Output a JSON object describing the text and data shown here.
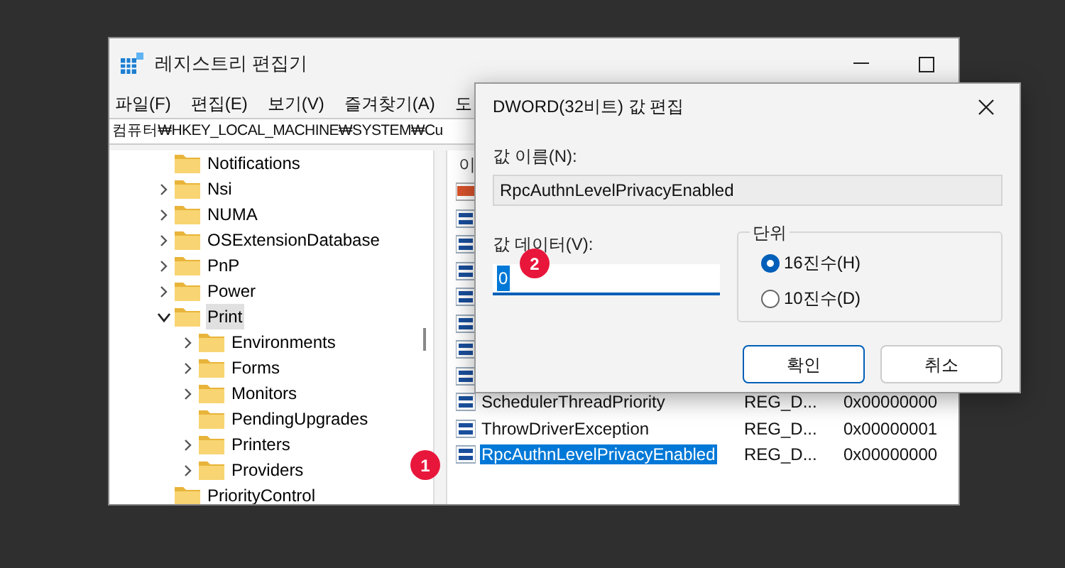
{
  "window": {
    "title": "레지스트리 편집기",
    "menu": [
      "파일(F)",
      "편집(E)",
      "보기(V)",
      "즐겨찾기(A)",
      "도"
    ],
    "address": "컴퓨터₩HKEY_LOCAL_MACHINE₩SYSTEM₩Cu"
  },
  "tree": [
    {
      "label": "Notifications",
      "selected": false
    },
    {
      "label": "Nsi",
      "expanded": false,
      "selected": false
    },
    {
      "label": "NUMA",
      "expanded": false,
      "selected": false
    },
    {
      "label": "OSExtensionDatabase",
      "expanded": false,
      "selected": false
    },
    {
      "label": "PnP",
      "expanded": false,
      "selected": false
    },
    {
      "label": "Power",
      "expanded": false,
      "selected": false
    },
    {
      "label": "Print",
      "expanded": true,
      "selected": true,
      "children": [
        {
          "label": "Environments",
          "expanded": false,
          "selected": false
        },
        {
          "label": "Forms",
          "expanded": false,
          "selected": false
        },
        {
          "label": "Monitors",
          "expanded": false,
          "selected": false
        },
        {
          "label": "PendingUpgrades",
          "selected": false
        },
        {
          "label": "Printers",
          "expanded": false,
          "selected": false
        },
        {
          "label": "Providers",
          "expanded": false,
          "selected": false
        }
      ]
    },
    {
      "label": "PriorityControl",
      "selected": false
    }
  ],
  "values": {
    "header": "이",
    "rows": [
      {
        "kind": "string"
      },
      {
        "kind": "dword"
      },
      {
        "kind": "dword"
      },
      {
        "kind": "dword"
      },
      {
        "kind": "dword"
      },
      {
        "kind": "dword"
      },
      {
        "kind": "dword"
      },
      {
        "kind": "dword"
      },
      {
        "kind": "dword",
        "name": "SchedulerThreadPriority",
        "type": "REG_D...",
        "data": "0x00000000",
        "selected": false
      },
      {
        "kind": "dword",
        "name": "ThrowDriverException",
        "type": "REG_D...",
        "data": "0x00000001",
        "selected": false
      },
      {
        "kind": "dword",
        "name": "RpcAuthnLevelPrivacyEnabled",
        "type": "REG_D...",
        "data": "0x00000000",
        "selected": true
      }
    ]
  },
  "dialog": {
    "title": "DWORD(32비트) 값 편집",
    "name_label": "값 이름(N):",
    "name_value": "RpcAuthnLevelPrivacyEnabled",
    "data_label": "값 데이터(V):",
    "data_value": "0",
    "base_label": "단위",
    "bases": [
      {
        "label": "16진수(H)",
        "selected": true
      },
      {
        "label": "10진수(D)",
        "selected": false
      }
    ],
    "buttons": [
      {
        "label": "확인",
        "default": true
      },
      {
        "label": "취소",
        "default": false
      }
    ]
  },
  "step_markers": [
    "1",
    "2"
  ]
}
